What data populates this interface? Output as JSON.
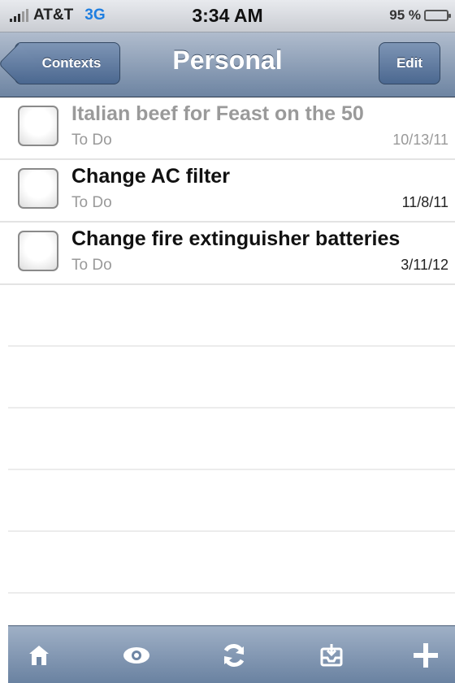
{
  "status_bar": {
    "carrier": "AT&T",
    "network": "3G",
    "time": "3:34 AM",
    "battery": "95 %",
    "battery_level": 0.95
  },
  "nav": {
    "back_label": "Contexts",
    "title": "Personal",
    "edit_label": "Edit"
  },
  "tasks": [
    {
      "title": "Italian beef for Feast on the 50",
      "context": "To Do",
      "date": "10/13/11",
      "completed": true
    },
    {
      "title": "Change AC filter",
      "context": "To Do",
      "date": "11/8/11",
      "completed": false
    },
    {
      "title": "Change fire extinguisher batteries",
      "context": "To Do",
      "date": "3/11/12",
      "completed": false
    }
  ],
  "toolbar": {
    "icons": [
      "home-icon",
      "eye-icon",
      "sync-icon",
      "inbox-icon",
      "plus-icon"
    ]
  },
  "colors": {
    "nav_top": "#b0bccd",
    "nav_bottom": "#6d84a2",
    "network": "#1e7ee0",
    "battery": "#24a524"
  }
}
